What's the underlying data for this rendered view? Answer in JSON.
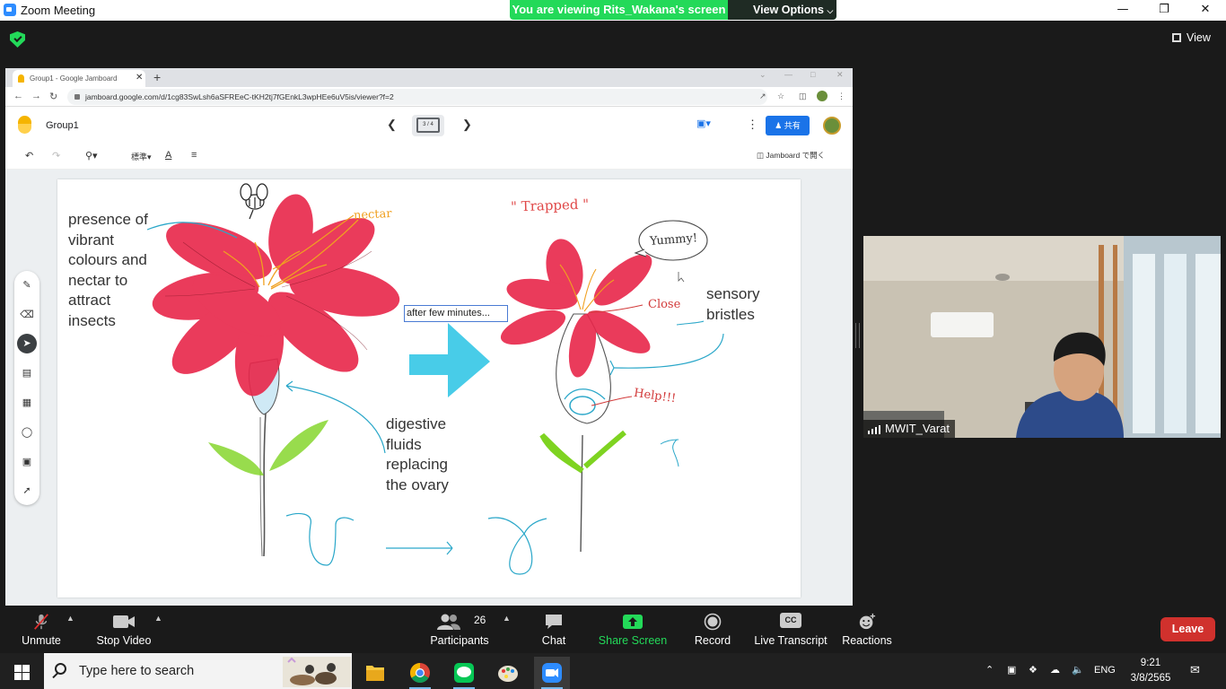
{
  "zoom": {
    "window_title": "Zoom Meeting",
    "banner_text": "You are viewing Rits_Wakana's screen",
    "view_options_label": "View Options",
    "view_label": "View",
    "controls": {
      "unmute": "Unmute",
      "stop_video": "Stop Video",
      "participants": "Participants",
      "participants_count": "26",
      "chat": "Chat",
      "share_screen": "Share Screen",
      "record": "Record",
      "live_transcript": "Live Transcript",
      "reactions": "Reactions",
      "leave": "Leave",
      "cc_badge": "CC"
    },
    "video": {
      "participant_name": "MWIT_Varat"
    }
  },
  "browser": {
    "tab_title": "Group1 - Google Jamboard",
    "url": "jamboard.google.com/d/1cg83SwLsh6aSFREeC-tKH2tj7fGEnkL3wpHEe6uV5is/viewer?f=2"
  },
  "jamboard": {
    "board_title": "Group1",
    "frame_counter": "3 / 4",
    "share_label": "共有",
    "zoom_style_label": "標準",
    "open_in_jamboard": "Jamboard で開く"
  },
  "canvas": {
    "note_left": [
      "presence of",
      "vibrant",
      "colours and",
      "nectar to",
      "attract",
      "insects"
    ],
    "note_digestive": [
      "digestive",
      "fluids",
      "replacing",
      "the ovary"
    ],
    "note_sensory": [
      "sensory",
      "bristles"
    ],
    "textbox": "after few minutes...",
    "hand_nectar": "nectar",
    "hand_trapped": "\" Trapped \"",
    "hand_yummy": "Yummy!",
    "hand_close": "Close",
    "hand_help": "Help!!!"
  },
  "taskbar": {
    "search_placeholder": "Type here to search",
    "language": "ENG",
    "time": "9:21",
    "date": "3/8/2565"
  },
  "colors": {
    "zoom_green": "#23d959",
    "leave_red": "#d0312d",
    "petal_red": "#e8264a",
    "cyan_arrow": "#34c6e6",
    "stroke_blue": "#2aa7c9",
    "nectar_orange": "#f0a020",
    "leaf_green": "#7ed321"
  }
}
